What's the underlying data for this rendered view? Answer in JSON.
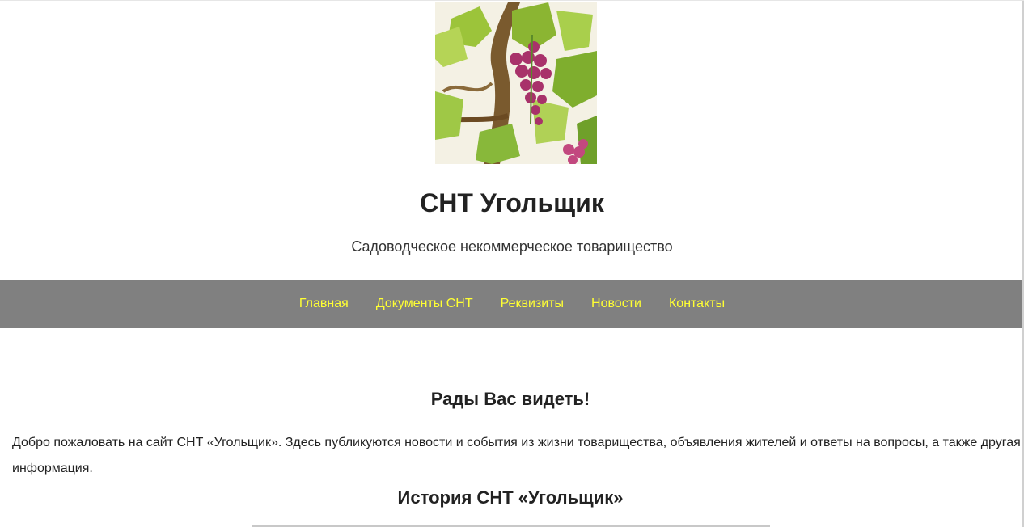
{
  "site": {
    "title": "СНТ Угольщик",
    "tagline": "Садоводческое некоммерческое товарищество",
    "logo_icon": "grapevine-logo"
  },
  "nav": {
    "items": [
      {
        "label": "Главная"
      },
      {
        "label": "Документы СНТ"
      },
      {
        "label": "Реквизиты"
      },
      {
        "label": "Новости"
      },
      {
        "label": "Контакты"
      }
    ],
    "background": "#808080",
    "link_color": "#ffff33"
  },
  "main": {
    "welcome_heading": "Рады Вас видеть!",
    "welcome_text": "Добро пожаловать на сайт СНТ «Угольщик». Здесь публикуются новости и события из жизни товарищества, объявления жителей и ответы на вопросы, а также другая информация.",
    "history_heading": "История СНТ «Угольщик»"
  }
}
